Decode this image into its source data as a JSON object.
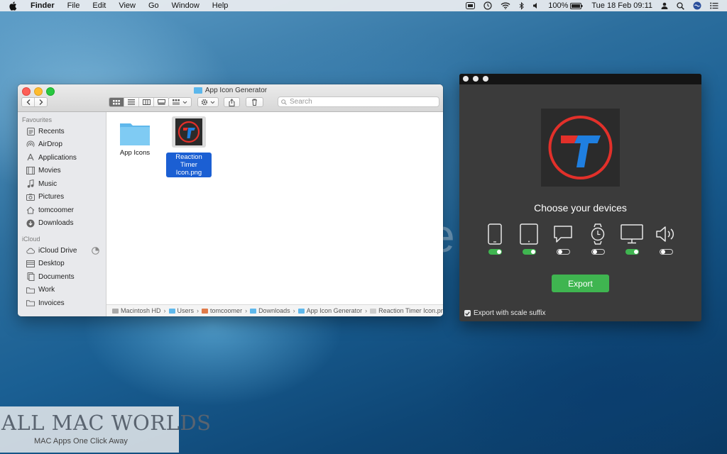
{
  "menubar": {
    "app_name": "Finder",
    "menus": [
      "File",
      "Edit",
      "View",
      "Go",
      "Window",
      "Help"
    ],
    "battery": "100%",
    "clock": "Tue 18 Feb  09:11"
  },
  "finder": {
    "title": "App Icon Generator",
    "search_placeholder": "Search",
    "sidebar": {
      "favourites_header": "Favourites",
      "favourites": [
        {
          "label": "Recents",
          "icon": "recents-icon"
        },
        {
          "label": "AirDrop",
          "icon": "airdrop-icon"
        },
        {
          "label": "Applications",
          "icon": "applications-icon"
        },
        {
          "label": "Movies",
          "icon": "movies-icon"
        },
        {
          "label": "Music",
          "icon": "music-icon"
        },
        {
          "label": "Pictures",
          "icon": "pictures-icon"
        },
        {
          "label": "tomcoomer",
          "icon": "home-icon"
        },
        {
          "label": "Downloads",
          "icon": "downloads-icon"
        }
      ],
      "icloud_header": "iCloud",
      "icloud": [
        {
          "label": "iCloud Drive",
          "icon": "icloud-drive-icon"
        },
        {
          "label": "Desktop",
          "icon": "desktop-icon"
        },
        {
          "label": "Documents",
          "icon": "documents-icon"
        },
        {
          "label": "Work",
          "icon": "folder-icon"
        },
        {
          "label": "Invoices",
          "icon": "folder-icon"
        }
      ]
    },
    "files": [
      {
        "name": "App Icons",
        "type": "folder",
        "selected": false
      },
      {
        "name_line1": "Reaction Timer",
        "name_line2": "Icon.png",
        "type": "image",
        "selected": true
      }
    ],
    "pathbar": [
      "Macintosh HD",
      "Users",
      "tomcoomer",
      "Downloads",
      "App Icon Generator",
      "Reaction Timer Icon.png"
    ]
  },
  "generator": {
    "heading": "Choose your devices",
    "devices": [
      {
        "icon": "iphone-icon",
        "enabled": true
      },
      {
        "icon": "ipad-icon",
        "enabled": true
      },
      {
        "icon": "imessage-icon",
        "enabled": false
      },
      {
        "icon": "watch-icon",
        "enabled": false
      },
      {
        "icon": "mac-icon",
        "enabled": true
      },
      {
        "icon": "speaker-icon",
        "enabled": false
      }
    ],
    "export_label": "Export",
    "scale_suffix_label": "Export with scale suffix",
    "scale_suffix_checked": true,
    "accent_color": "#3fb550",
    "icon_red": "#e2302a",
    "icon_blue": "#1f7fe0"
  },
  "watermark": {
    "line1": "ALL MAC WORLDS",
    "line2": "MAC Apps One Click Away"
  }
}
